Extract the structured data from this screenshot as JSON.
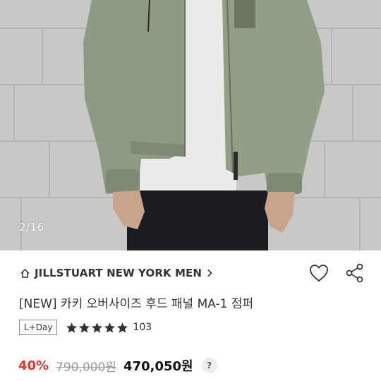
{
  "gallery": {
    "counter": "2/16",
    "image_alt": "khaki oversized hooded MA-1 jumper worn by model"
  },
  "brand": {
    "icon": "home-icon",
    "name": "JILLSTUART NEW YORK MEN",
    "chevron_icon": "chevron-right-icon"
  },
  "actions": {
    "wishlist_icon": "heart-icon",
    "share_icon": "share-icon"
  },
  "product": {
    "title": "[NEW] 카키 오버사이즈 후드 패널 MA-1 점퍼",
    "badge": "L+Day",
    "rating_stars": 5,
    "review_count": "103"
  },
  "price": {
    "discount": "40%",
    "original": "790,000원",
    "sale": "470,050원",
    "help_label": "?"
  },
  "colors": {
    "discount": "#e8302f",
    "star": "#333333",
    "jacket": "#8e9a82"
  }
}
